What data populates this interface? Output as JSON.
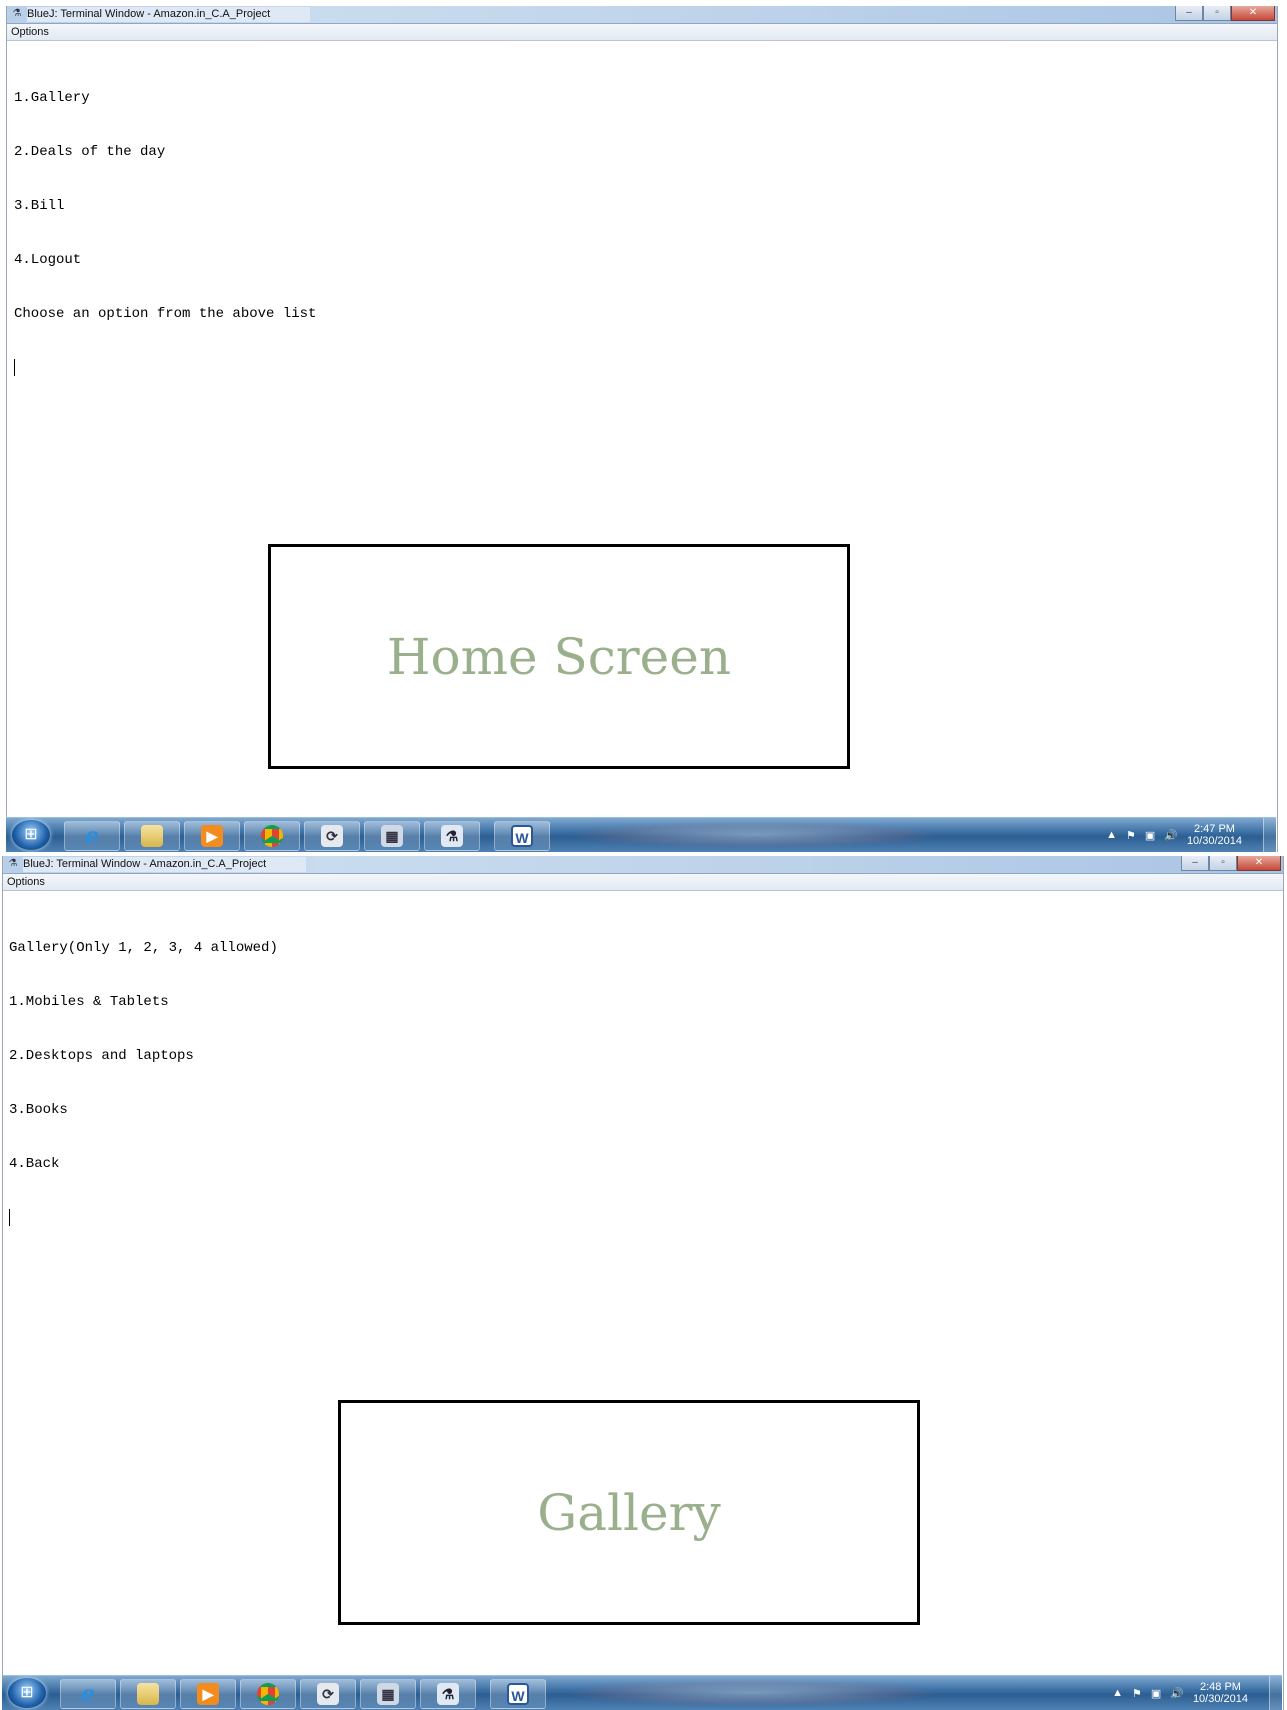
{
  "screens": [
    {
      "window_title": "BlueJ: Terminal Window - Amazon.in_C.A_Project",
      "menu_options": "Options",
      "terminal_lines": [
        "1.Gallery",
        "2.Deals of the day",
        "3.Bill",
        "4.Logout",
        "Choose an option from the above list"
      ],
      "caption": "Home Screen",
      "clock_time": "2:47 PM",
      "clock_date": "10/30/2014"
    },
    {
      "window_title": "BlueJ: Terminal Window - Amazon.in_C.A_Project",
      "menu_options": "Options",
      "terminal_lines": [
        "Gallery(Only 1, 2, 3, 4 allowed)",
        "1.Mobiles & Tablets",
        "2.Desktops and laptops",
        "3.Books",
        "4.Back"
      ],
      "caption": "Gallery",
      "clock_time": "2:48 PM",
      "clock_date": "10/30/2014"
    }
  ],
  "window_controls": {
    "minimize": "–",
    "maximize": "▫",
    "close": "✕"
  },
  "taskbar_icons": [
    "start-orb",
    "internet-explorer",
    "windows-explorer",
    "media-player",
    "chrome",
    "misc-app",
    "calculator",
    "bluej",
    "word"
  ],
  "colors": {
    "caption_text": "#9aaf8c",
    "taskbar": "#2c5e92",
    "titlebar": "#bdd2ea"
  }
}
